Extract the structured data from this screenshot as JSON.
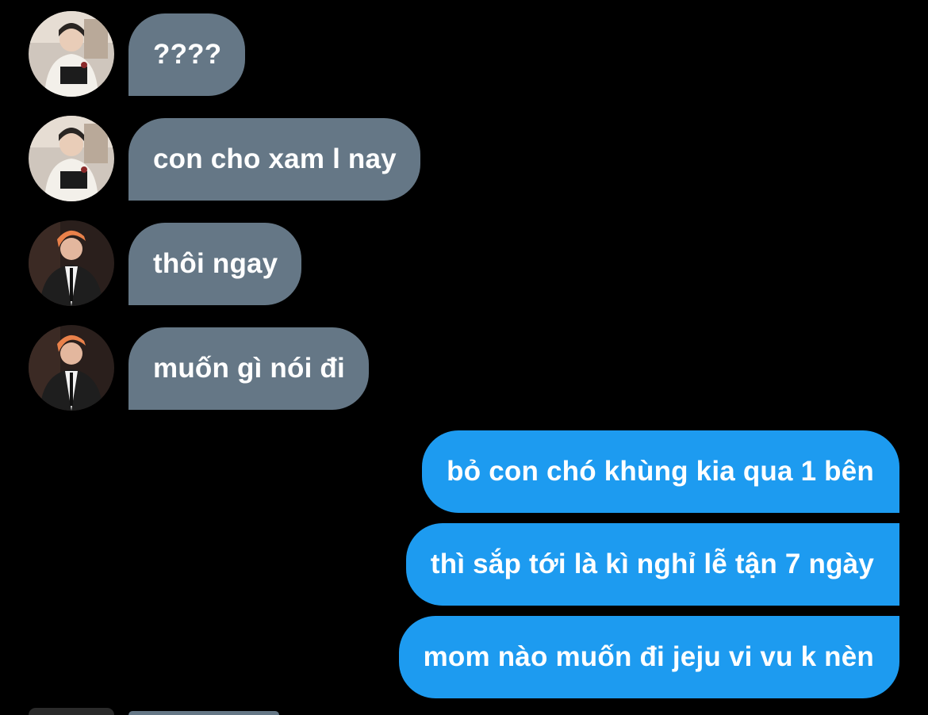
{
  "conversation": {
    "incoming": [
      {
        "text": "????",
        "avatar": "user-a-avatar"
      },
      {
        "text": "con cho xam l nay",
        "avatar": "user-a-avatar"
      },
      {
        "text": "thôi ngay",
        "avatar": "user-b-avatar"
      },
      {
        "text": "muốn gì nói đi",
        "avatar": "user-b-avatar"
      }
    ],
    "outgoing": [
      {
        "text": "bỏ con chó khùng kia qua 1 bên"
      },
      {
        "text": "thì sắp tới là kì nghỉ lễ tận 7 ngày"
      },
      {
        "text": "mom nào muốn đi jeju vi vu k nèn"
      }
    ]
  },
  "colors": {
    "background": "#000000",
    "incoming_bubble": "#657786",
    "outgoing_bubble": "#1d9bf0",
    "text": "#ffffff"
  }
}
